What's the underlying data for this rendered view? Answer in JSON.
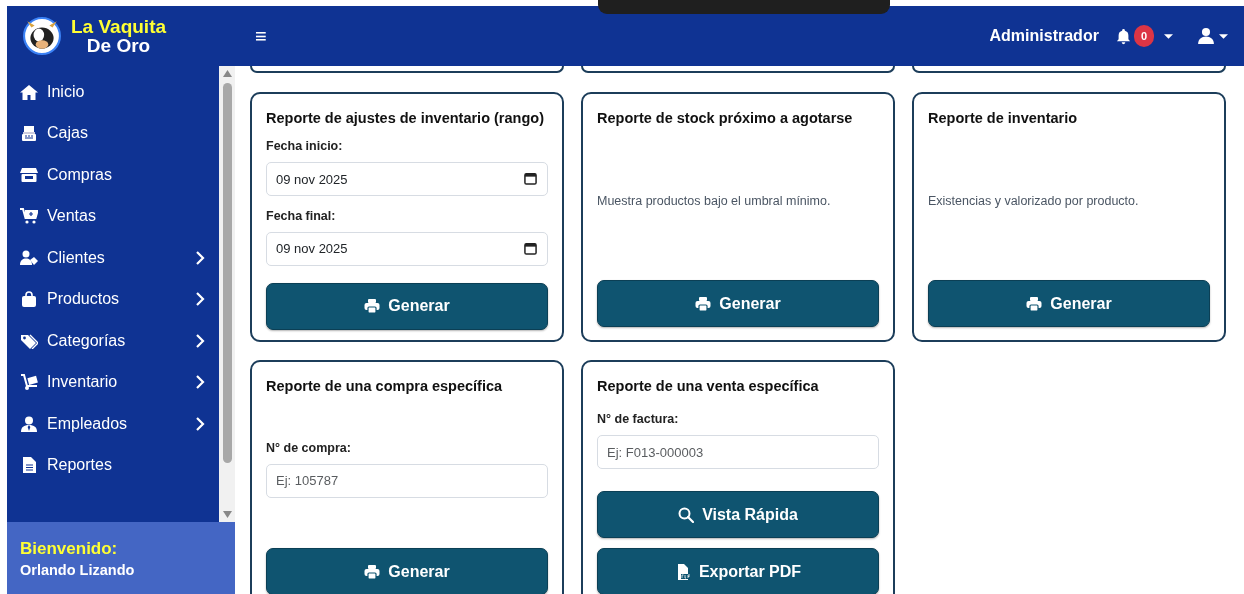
{
  "brand": {
    "line_1": "La Vaquita",
    "line_2": "De Oro"
  },
  "menu_toggle": "≡",
  "navbar": {
    "user_role": "Administrador",
    "notification_count": "0"
  },
  "sidebar": {
    "items": [
      {
        "label": "Inicio",
        "expandable": false
      },
      {
        "label": "Cajas",
        "expandable": false
      },
      {
        "label": "Compras",
        "expandable": false
      },
      {
        "label": "Ventas",
        "expandable": false
      },
      {
        "label": "Clientes",
        "expandable": true
      },
      {
        "label": "Productos",
        "expandable": true
      },
      {
        "label": "Categorías",
        "expandable": true
      },
      {
        "label": "Inventario",
        "expandable": true
      },
      {
        "label": "Empleados",
        "expandable": true
      },
      {
        "label": "Reportes",
        "expandable": false
      }
    ]
  },
  "welcome": {
    "greeting": "Bienvenido:",
    "user_name": "Orlando Lizando"
  },
  "report_cards": [
    {
      "title": "Reporte de ajustes de inventario (rango)",
      "fields": [
        {
          "kind": "date",
          "label": "Fecha inicio:",
          "value": "09 nov 2025"
        },
        {
          "kind": "date",
          "label": "Fecha final:",
          "value": "09 nov 2025"
        }
      ],
      "buttons": [
        {
          "kind": "print",
          "label": "Generar"
        }
      ]
    },
    {
      "title": "Reporte de stock próximo a agotarse",
      "description": "Muestra productos bajo el umbral mínimo.",
      "buttons": [
        {
          "kind": "print",
          "label": "Generar"
        }
      ]
    },
    {
      "title": "Reporte de inventario",
      "description": "Existencias y valorizado por producto.",
      "buttons": [
        {
          "kind": "print",
          "label": "Generar"
        }
      ]
    },
    {
      "title": "Reporte de una compra específica",
      "fields": [
        {
          "kind": "text",
          "label": "N° de compra:",
          "placeholder": "Ej: 105787"
        }
      ],
      "buttons": [
        {
          "kind": "print",
          "label": "Generar"
        }
      ]
    },
    {
      "title": "Reporte de una venta específica",
      "fields": [
        {
          "kind": "text",
          "label": "N° de factura:",
          "placeholder": "Ej: F013-000003"
        }
      ],
      "buttons": [
        {
          "kind": "search",
          "label": "Vista Rápida"
        },
        {
          "kind": "pdf",
          "label": "Exportar PDF"
        }
      ]
    }
  ]
}
